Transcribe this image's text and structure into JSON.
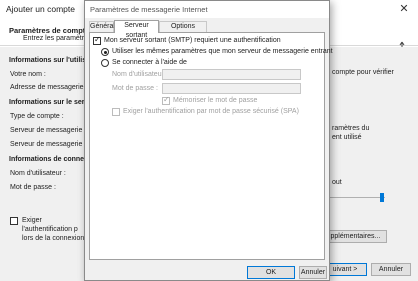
{
  "wizard": {
    "title": "Ajouter un compte",
    "header_title": "Paramètres de compte P",
    "header_sub": "Entrez les paramètres c",
    "user_info_heading": "Informations sur l'utilisat",
    "your_name_label": "Votre nom :",
    "email_label": "Adresse de messagerie :",
    "server_info_heading": "Informations sur le serveu",
    "account_type_label": "Type de compte :",
    "incoming_server_label": "Serveur de messagerie entr",
    "outgoing_server_label": "Serveur de messagerie sort",
    "login_heading": "Informations de connexio",
    "username_label": "Nom d'utilisateur :",
    "password_label": "Mot de passe :",
    "spa_line1": "Exiger l'authentification p",
    "spa_line2": "lors de la connexion",
    "right_text_1": "compte pour vérifier",
    "right_text_2": "ramètres du",
    "right_text_3": "ent utilisé",
    "right_text_4": "out",
    "more_settings_button": "s supplémentaires...",
    "next_button": "uivant >",
    "cancel_button": "Annuler"
  },
  "dialog": {
    "title": "Paramètres de messagerie Internet",
    "tabs": [
      {
        "label": "Général"
      },
      {
        "label": "Serveur sortant"
      },
      {
        "label": "Options avancées"
      }
    ],
    "requires_auth_label": "Mon serveur sortant (SMTP) requiert une authentification",
    "requires_auth_checked": true,
    "use_same_label": "Utiliser les mêmes paramètres que mon serveur de messagerie entrant",
    "connect_with_label": "Se connecter à l'aide de",
    "username_label": "Nom d'utilisateur :",
    "password_label": "Mot de passe :",
    "remember_password_label": "Mémoriser le mot de passe",
    "remember_password_checked": true,
    "spa_label": "Exiger l'authentification par mot de passe sécurisé (SPA)",
    "spa_checked": false,
    "ok_button": "OK",
    "cancel_button": "Annuler"
  },
  "colors": {
    "accent": "#0078d7",
    "dialog_bg": "#f0f0f0",
    "panel_bg": "#ffffff",
    "disabled_text": "#a0a0a0"
  }
}
